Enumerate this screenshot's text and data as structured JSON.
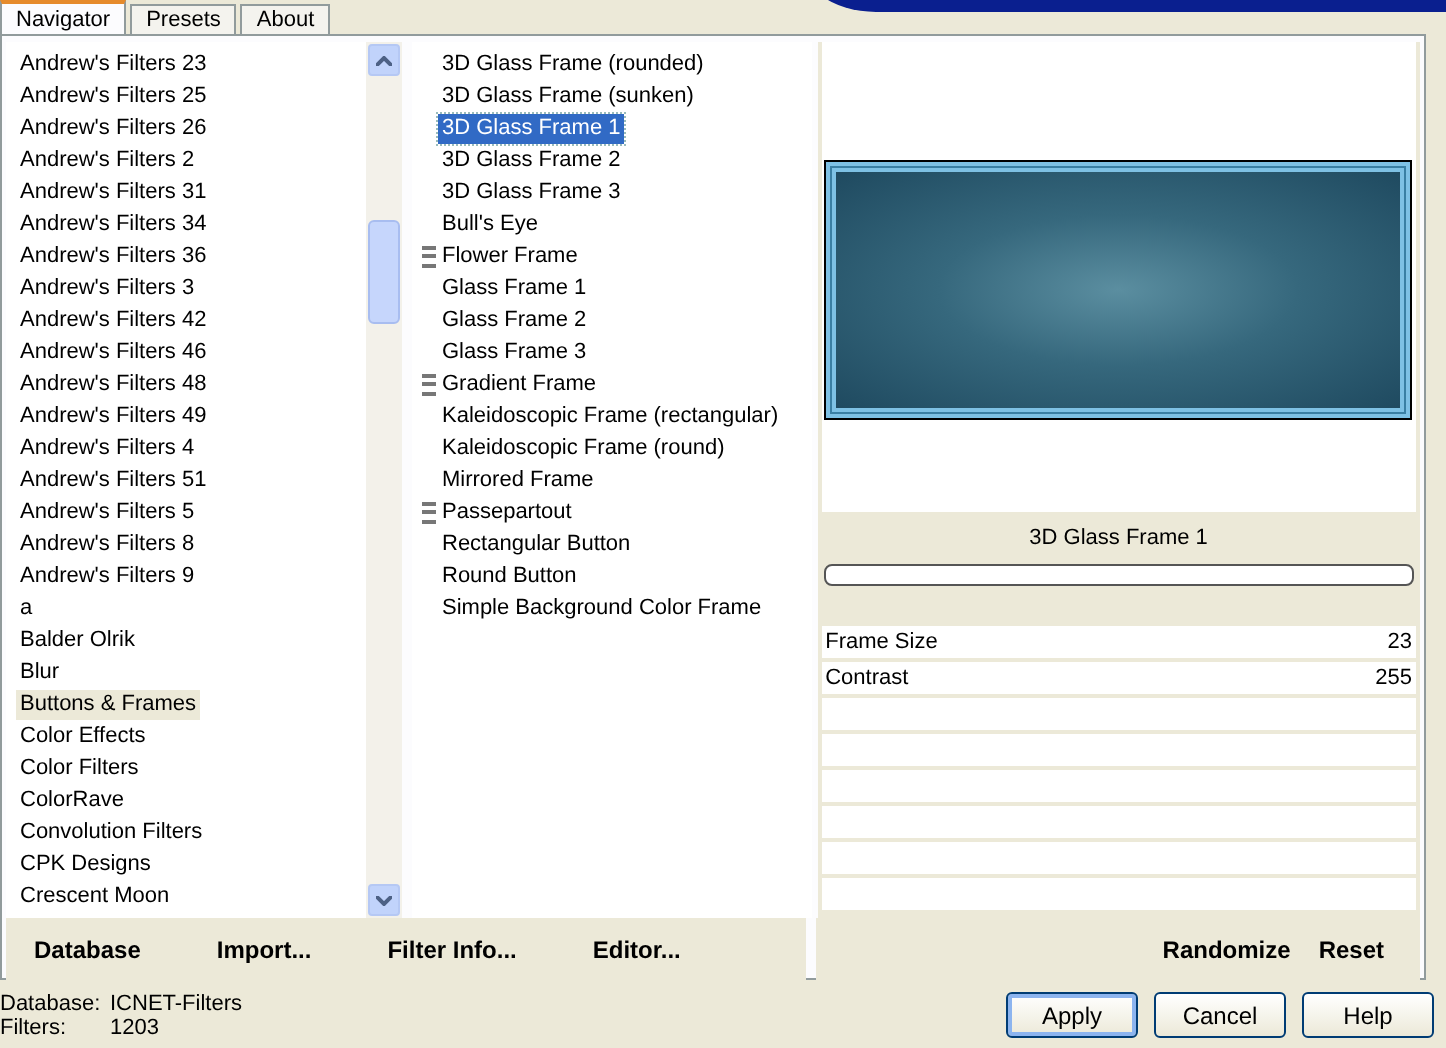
{
  "tabs": [
    {
      "label": "Navigator",
      "selected": true
    },
    {
      "label": "Presets",
      "selected": false
    },
    {
      "label": "About",
      "selected": false
    }
  ],
  "categories": [
    {
      "label": "Andrew's Filters 23",
      "selected": false
    },
    {
      "label": "Andrew's Filters 25",
      "selected": false
    },
    {
      "label": "Andrew's Filters 26",
      "selected": false
    },
    {
      "label": "Andrew's Filters 2",
      "selected": false
    },
    {
      "label": "Andrew's Filters 31",
      "selected": false
    },
    {
      "label": "Andrew's Filters 34",
      "selected": false
    },
    {
      "label": "Andrew's Filters 36",
      "selected": false
    },
    {
      "label": "Andrew's Filters 3",
      "selected": false
    },
    {
      "label": "Andrew's Filters 42",
      "selected": false
    },
    {
      "label": "Andrew's Filters 46",
      "selected": false
    },
    {
      "label": "Andrew's Filters 48",
      "selected": false
    },
    {
      "label": "Andrew's Filters 49",
      "selected": false
    },
    {
      "label": "Andrew's Filters 4",
      "selected": false
    },
    {
      "label": "Andrew's Filters 51",
      "selected": false
    },
    {
      "label": "Andrew's Filters 5",
      "selected": false
    },
    {
      "label": "Andrew's Filters 8",
      "selected": false
    },
    {
      "label": "Andrew's Filters 9",
      "selected": false
    },
    {
      "label": "a",
      "selected": false
    },
    {
      "label": "Balder Olrik",
      "selected": false
    },
    {
      "label": "Blur",
      "selected": false
    },
    {
      "label": "Buttons & Frames",
      "selected": true
    },
    {
      "label": "Color Effects",
      "selected": false
    },
    {
      "label": "Color Filters",
      "selected": false
    },
    {
      "label": "ColorRave",
      "selected": false
    },
    {
      "label": "Convolution Filters",
      "selected": false
    },
    {
      "label": "CPK Designs",
      "selected": false
    },
    {
      "label": "Crescent Moon",
      "selected": false
    }
  ],
  "filters": [
    {
      "label": "3D Glass Frame (rounded)",
      "selected": false,
      "marked": false
    },
    {
      "label": "3D Glass Frame (sunken)",
      "selected": false,
      "marked": false
    },
    {
      "label": "3D Glass Frame 1",
      "selected": true,
      "marked": false
    },
    {
      "label": "3D Glass Frame 2",
      "selected": false,
      "marked": false
    },
    {
      "label": "3D Glass Frame 3",
      "selected": false,
      "marked": false
    },
    {
      "label": "Bull's Eye",
      "selected": false,
      "marked": false
    },
    {
      "label": "Flower Frame",
      "selected": false,
      "marked": true
    },
    {
      "label": "Glass Frame 1",
      "selected": false,
      "marked": false
    },
    {
      "label": "Glass Frame 2",
      "selected": false,
      "marked": false
    },
    {
      "label": "Glass Frame 3",
      "selected": false,
      "marked": false
    },
    {
      "label": "Gradient Frame",
      "selected": false,
      "marked": true
    },
    {
      "label": "Kaleidoscopic Frame (rectangular)",
      "selected": false,
      "marked": false
    },
    {
      "label": "Kaleidoscopic Frame (round)",
      "selected": false,
      "marked": false
    },
    {
      "label": "Mirrored Frame",
      "selected": false,
      "marked": false
    },
    {
      "label": "Passepartout",
      "selected": false,
      "marked": true
    },
    {
      "label": "Rectangular Button",
      "selected": false,
      "marked": false
    },
    {
      "label": "Round Button",
      "selected": false,
      "marked": false
    },
    {
      "label": "Simple Background Color Frame",
      "selected": false,
      "marked": false
    }
  ],
  "preview_title": "3D Glass Frame 1",
  "progress": {
    "level": 0
  },
  "parameters": [
    {
      "name": "Frame Size",
      "value": "23"
    },
    {
      "name": "Contrast",
      "value": "255"
    }
  ],
  "left_buttons": [
    "Database",
    "Import...",
    "Filter Info...",
    "Editor..."
  ],
  "right_buttons": [
    "Randomize",
    "Reset"
  ],
  "status": [
    {
      "label": "Database:",
      "value": "ICNET-Filters"
    },
    {
      "label": "Filters:",
      "value": "1203"
    }
  ],
  "dialog_buttons": [
    {
      "label": "Apply",
      "default": true
    },
    {
      "label": "Cancel",
      "default": false
    },
    {
      "label": "Help",
      "default": false
    }
  ]
}
